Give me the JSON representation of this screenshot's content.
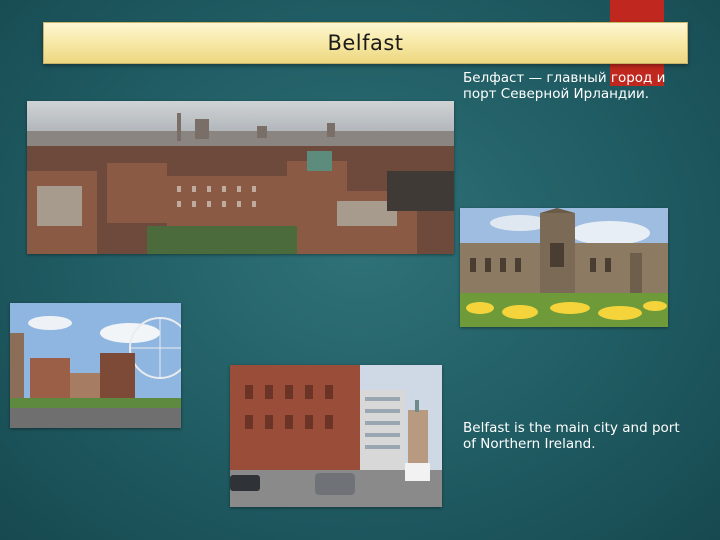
{
  "slide": {
    "title": "Belfast",
    "text_ru": "Белфаст — главный город и порт Северной Ирландии.",
    "text_en": "Belfast is the main city and port of Northern Ireland."
  },
  "photos": [
    {
      "name": "city-panorama-photo"
    },
    {
      "name": "university-building-photo"
    },
    {
      "name": "ferris-wheel-square-photo"
    },
    {
      "name": "street-view-photo"
    }
  ],
  "colors": {
    "background": "#205c63",
    "title_bar": "#f7e9a6",
    "accent_tab": "#c0271e",
    "text": "#ffffff"
  }
}
